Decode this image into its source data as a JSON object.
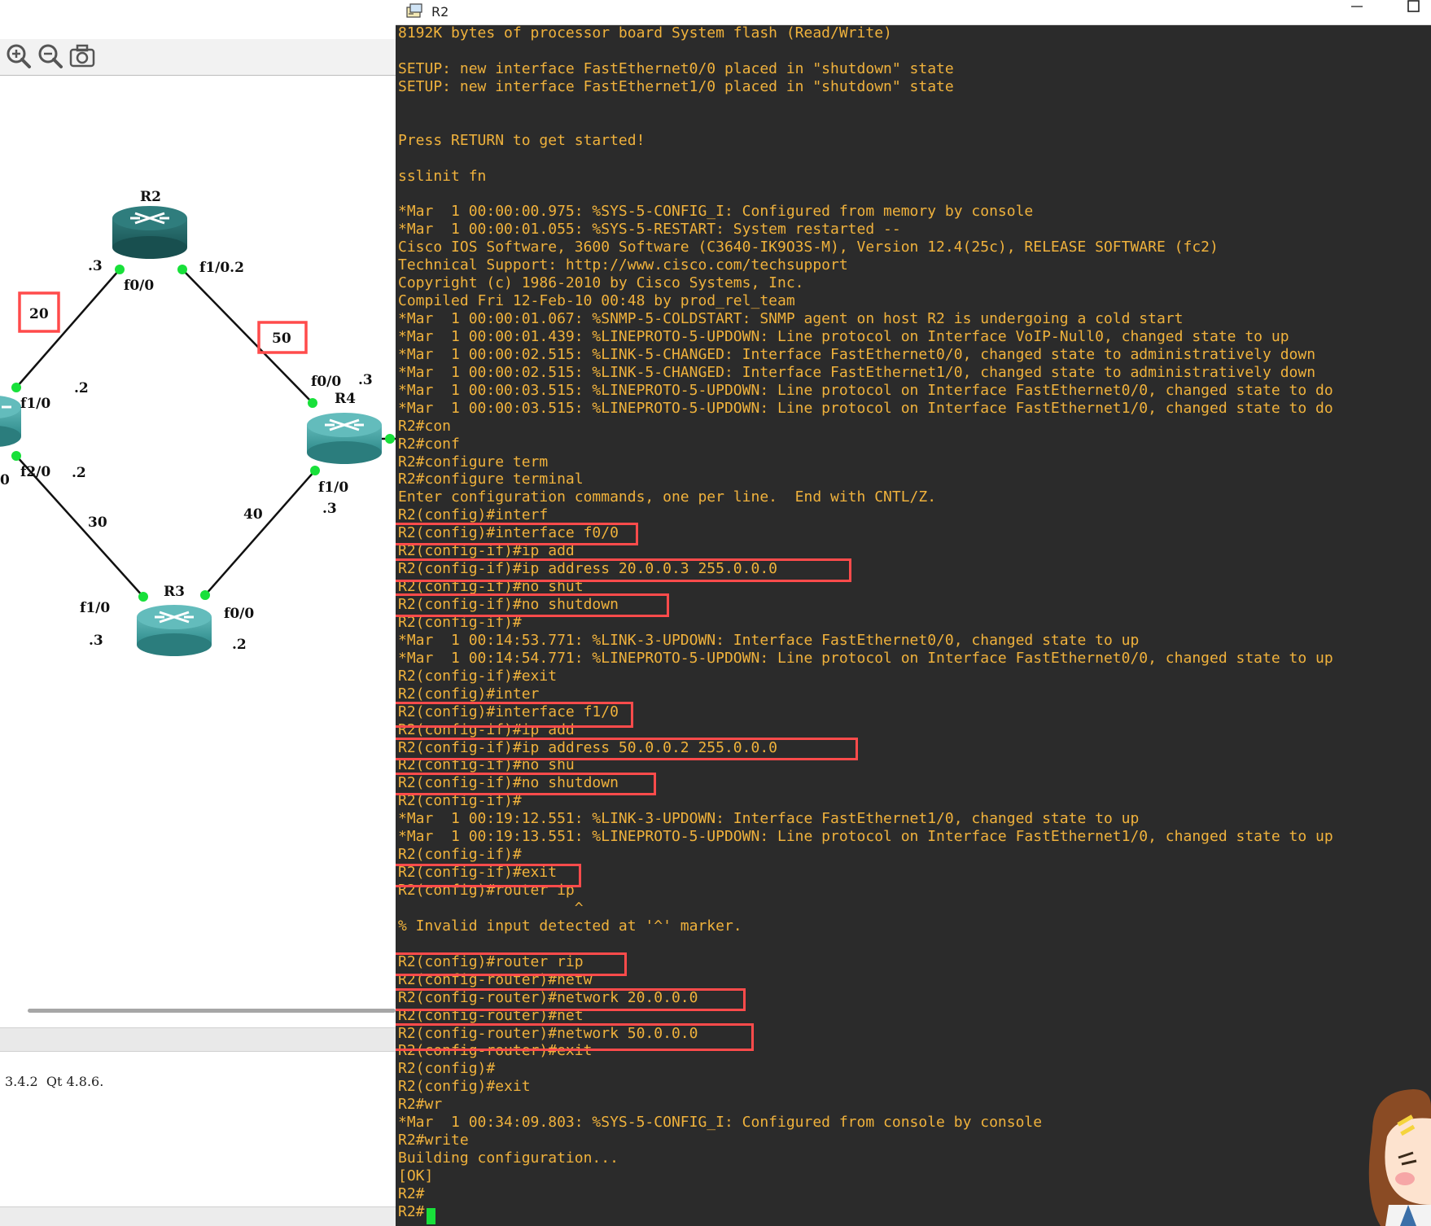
{
  "terminal": {
    "title": "R2",
    "lines": [
      "8192K bytes of processor board System flash (Read/Write)",
      "",
      "SETUP: new interface FastEthernet0/0 placed in \"shutdown\" state",
      "SETUP: new interface FastEthernet1/0 placed in \"shutdown\" state",
      "",
      "",
      "Press RETURN to get started!",
      "",
      "sslinit fn",
      "",
      "*Mar  1 00:00:00.975: %SYS-5-CONFIG_I: Configured from memory by console",
      "*Mar  1 00:00:01.055: %SYS-5-RESTART: System restarted --",
      "Cisco IOS Software, 3600 Software (C3640-IK9O3S-M), Version 12.4(25c), RELEASE SOFTWARE (fc2)",
      "Technical Support: http://www.cisco.com/techsupport",
      "Copyright (c) 1986-2010 by Cisco Systems, Inc.",
      "Compiled Fri 12-Feb-10 00:48 by prod_rel_team",
      "*Mar  1 00:00:01.067: %SNMP-5-COLDSTART: SNMP agent on host R2 is undergoing a cold start",
      "*Mar  1 00:00:01.439: %LINEPROTO-5-UPDOWN: Line protocol on Interface VoIP-Null0, changed state to up",
      "*Mar  1 00:00:02.515: %LINK-5-CHANGED: Interface FastEthernet0/0, changed state to administratively down",
      "*Mar  1 00:00:02.515: %LINK-5-CHANGED: Interface FastEthernet1/0, changed state to administratively down",
      "*Mar  1 00:00:03.515: %LINEPROTO-5-UPDOWN: Line protocol on Interface FastEthernet0/0, changed state to do",
      "*Mar  1 00:00:03.515: %LINEPROTO-5-UPDOWN: Line protocol on Interface FastEthernet1/0, changed state to do",
      "R2#con",
      "R2#conf",
      "R2#configure term",
      "R2#configure terminal",
      "Enter configuration commands, one per line.  End with CNTL/Z.",
      "R2(config)#interf",
      "R2(config)#interface f0/0",
      "R2(config-if)#ip add",
      "R2(config-if)#ip address 20.0.0.3 255.0.0.0",
      "R2(config-if)#no shut",
      "R2(config-if)#no shutdown",
      "R2(config-if)#",
      "*Mar  1 00:14:53.771: %LINK-3-UPDOWN: Interface FastEthernet0/0, changed state to up",
      "*Mar  1 00:14:54.771: %LINEPROTO-5-UPDOWN: Line protocol on Interface FastEthernet0/0, changed state to up",
      "R2(config-if)#exit",
      "R2(config)#inter",
      "R2(config)#interface f1/0",
      "R2(config-if)#ip add",
      "R2(config-if)#ip address 50.0.0.2 255.0.0.0",
      "R2(config-if)#no shu",
      "R2(config-if)#no shutdown",
      "R2(config-if)#",
      "*Mar  1 00:19:12.551: %LINK-3-UPDOWN: Interface FastEthernet1/0, changed state to up",
      "*Mar  1 00:19:13.551: %LINEPROTO-5-UPDOWN: Line protocol on Interface FastEthernet1/0, changed state to up",
      "R2(config-if)#",
      "R2(config-if)#exit",
      "R2(config)#router ip",
      "                    ^",
      "% Invalid input detected at '^' marker.",
      "",
      "R2(config)#router rip",
      "R2(config-router)#netw",
      "R2(config-router)#network 20.0.0.0",
      "R2(config-router)#net",
      "R2(config-router)#network 50.0.0.0",
      "R2(config-router)#exit",
      "R2(config)#",
      "R2(config)#exit",
      "R2#wr",
      "*Mar  1 00:34:09.803: %SYS-5-CONFIG_I: Configured from console by console",
      "R2#write",
      "Building configuration...",
      "[OK]",
      "R2#",
      "R2#"
    ]
  },
  "topology": {
    "routers": {
      "r2": "R2",
      "r3": "R3",
      "r4": "R4"
    },
    "labels": {
      "r2_f00": "f0/0",
      "r2_f00_addr": ".3",
      "r2_f10": "f1/0.2",
      "r1_f10": "f1/0",
      "r1_f10_addr": ".2",
      "r1_f20": "f2/0",
      "r1_f20_addr": ".2",
      "r1_edge": "0",
      "r4_f00": "f0/0",
      "r4_f00_addr": ".3",
      "r4_f10": "f1/0",
      "r4_f10_addr": ".3",
      "r3_f10": "f1/0",
      "r3_f10_addr": ".3",
      "r3_f00": "f0/0",
      "r3_f00_addr": ".2"
    },
    "link_nets": {
      "net_20": "20",
      "net_50": "50",
      "net_30": "30",
      "net_40": "40"
    }
  },
  "toolbar": {
    "zoom_in_icon": "zoom-in-icon",
    "zoom_out_icon": "zoom-out-icon",
    "screenshot_icon": "camera-icon"
  },
  "status": {
    "version": "3.4.2  Qt 4.8.6."
  },
  "colors": {
    "terminal_bg": "#2b2b2b",
    "terminal_text": "#f0b23c",
    "highlight": "#ff4b4b",
    "link_up": "#18e03a",
    "router": "#2e8a8a"
  }
}
